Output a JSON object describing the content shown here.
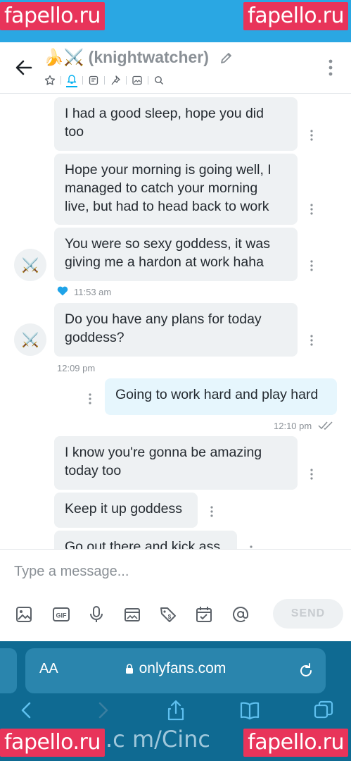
{
  "watermarks": {
    "top_left": "fapello.ru",
    "top_right": "fapello.ru",
    "bottom_left": "fapello.ru",
    "bottom_right": "fapello.ru"
  },
  "header": {
    "title": "🍌⚔️ (knightwatcher)",
    "icons": [
      "star-icon",
      "bell-icon",
      "note-icon",
      "pin-icon",
      "image-icon",
      "search-icon"
    ]
  },
  "messages": [
    {
      "side": "in",
      "text_lines": [
        "I had a good sleep, hope you did",
        "too"
      ]
    },
    {
      "side": "in",
      "text_lines": [
        "Hope your morning is going well, I",
        "managed to catch your morning",
        "live, but had to head back to work"
      ]
    },
    {
      "side": "in",
      "text_lines": [
        "You were so sexy goddess, it was",
        "giving me a hardon at work haha"
      ],
      "avatar": "⚔️",
      "liked": true,
      "time": "11:53 am"
    },
    {
      "side": "in",
      "text_lines": [
        "Do you have any plans for today",
        "goddess?"
      ],
      "avatar": "⚔️",
      "time": "12:09 pm"
    },
    {
      "side": "out",
      "text_lines": [
        "Going to work hard and play hard"
      ],
      "time": "12:10 pm",
      "read": true
    },
    {
      "side": "in",
      "text_lines": [
        "I know you're gonna be amazing",
        "today too"
      ]
    },
    {
      "side": "in",
      "text_lines": [
        "Keep it up goddess"
      ]
    },
    {
      "side": "in",
      "text_lines": [
        "Go out there and kick ass"
      ]
    }
  ],
  "composer": {
    "placeholder": "Type a message...",
    "tools": [
      "image-icon",
      "gif-icon",
      "microphone-icon",
      "vault-icon",
      "price-tag-icon",
      "calendar-check-icon",
      "mention-icon"
    ],
    "send_label": "SEND"
  },
  "browser": {
    "aa_label": "AA",
    "url": "onlyfans.com",
    "footer_text": ".c m/Cinc"
  },
  "colors": {
    "status_bar": "#2aa7e3",
    "accent": "#00aff0",
    "browser_bar": "#0f6a92"
  }
}
